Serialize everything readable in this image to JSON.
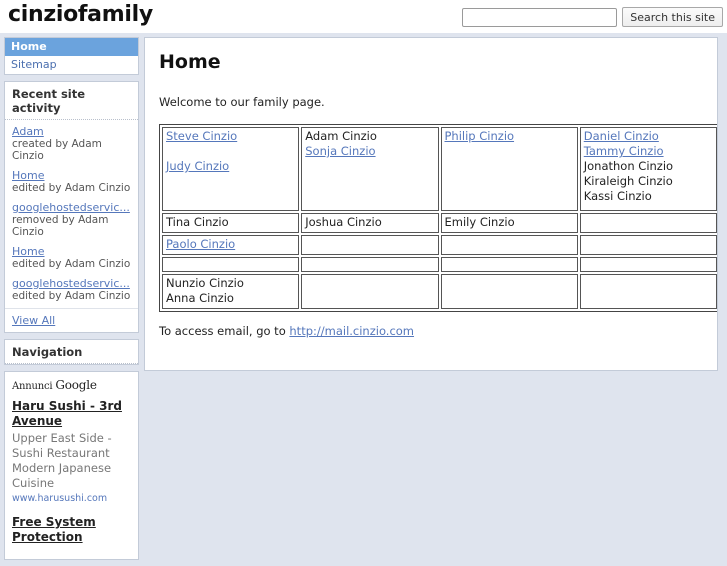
{
  "header": {
    "site_title": "cinziofamily",
    "search": {
      "value": "",
      "placeholder": "",
      "button_label": "Search this site"
    }
  },
  "sidebar": {
    "nav": {
      "items": [
        {
          "label": "Home",
          "selected": true
        },
        {
          "label": "Sitemap",
          "selected": false
        }
      ]
    },
    "recent_activity": {
      "heading": "Recent site activity",
      "items": [
        {
          "link": "Adam",
          "meta": "created by Adam Cinzio"
        },
        {
          "link": "Home",
          "meta": "edited by Adam Cinzio"
        },
        {
          "link": "googlehostedservic...",
          "meta": "removed by Adam Cinzio"
        },
        {
          "link": "Home",
          "meta": "edited by Adam Cinzio"
        },
        {
          "link": "googlehostedservic...",
          "meta": "edited by Adam Cinzio"
        }
      ],
      "view_all_label": "View All"
    },
    "navigation": {
      "heading": "Navigation"
    },
    "ads": {
      "label_prefix": "Annunci",
      "label_brand": "Google",
      "items": [
        {
          "title": "Haru Sushi - 3rd Avenue",
          "description": "Upper East Side - Sushi Restaurant Modern Japanese Cuisine",
          "url": "www.harusushi.com"
        },
        {
          "title": "Free System Protection",
          "description": "",
          "url": ""
        }
      ]
    }
  },
  "main": {
    "page_title": "Home",
    "intro_text": "Welcome to our family page.",
    "family_table": {
      "rows": [
        {
          "size": "tall",
          "cells": [
            [
              {
                "text": "Steve Cinzio",
                "link": true
              },
              {
                "text": "",
                "gap": true
              },
              {
                "text": "Judy Cinzio",
                "link": true
              }
            ],
            [
              {
                "text": "Adam Cinzio",
                "link": false
              },
              {
                "text": "Sonja Cinzio",
                "link": true
              }
            ],
            [
              {
                "text": "Philip Cinzio",
                "link": true
              }
            ],
            [
              {
                "text": "Daniel Cinzio",
                "link": true
              },
              {
                "text": "Tammy Cinzio",
                "link": true
              },
              {
                "text": "Jonathon Cinzio",
                "link": false
              },
              {
                "text": "Kiraleigh Cinzio",
                "link": false
              },
              {
                "text": "Kassi Cinzio",
                "link": false
              }
            ]
          ]
        },
        {
          "size": "short",
          "cells": [
            [
              {
                "text": "Tina Cinzio",
                "link": false
              }
            ],
            [
              {
                "text": "Joshua Cinzio",
                "link": false
              }
            ],
            [
              {
                "text": "Emily Cinzio",
                "link": false
              }
            ],
            []
          ]
        },
        {
          "size": "short",
          "cells": [
            [
              {
                "text": "Paolo Cinzio",
                "link": true
              }
            ],
            [],
            [],
            []
          ]
        },
        {
          "size": "short",
          "cells": [
            [],
            [],
            [],
            []
          ]
        },
        {
          "size": "med",
          "cells": [
            [
              {
                "text": "Nunzio Cinzio",
                "link": false
              },
              {
                "text": "Anna Cinzio",
                "link": false
              }
            ],
            [],
            [],
            []
          ]
        }
      ]
    },
    "email_note": {
      "prefix": "To access email, go to ",
      "link_text": "http://mail.cinzio.com"
    }
  },
  "colors": {
    "page_background": "#dfe4ee",
    "panel_background": "#ffffff",
    "panel_border": "#c3cbd8",
    "link": "#5577bb",
    "nav_selected_background": "#6ba3dd",
    "nav_selected_text": "#ffffff",
    "table_border": "#555555",
    "muted_text": "#777777"
  }
}
